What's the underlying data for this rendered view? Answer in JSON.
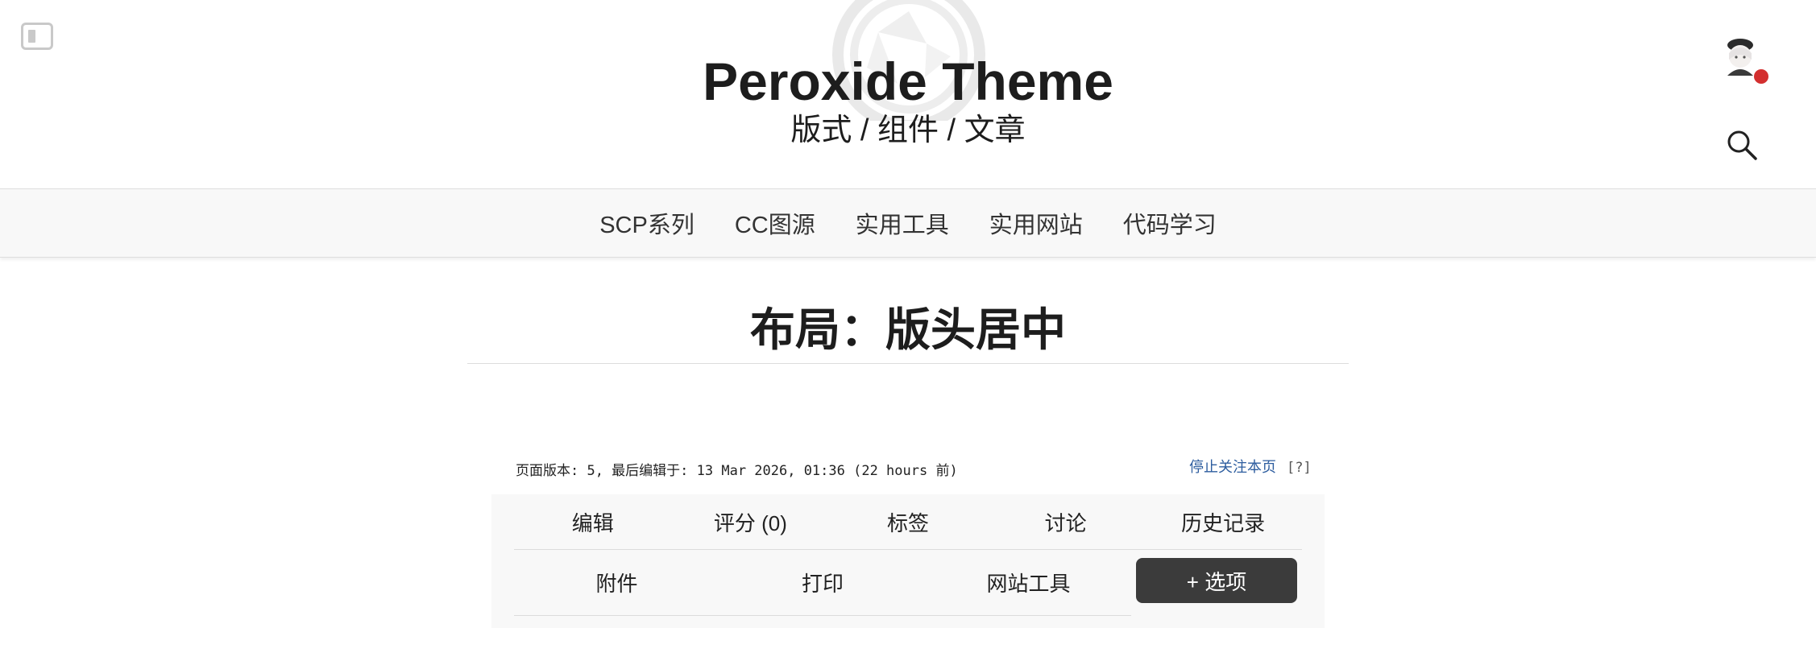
{
  "header": {
    "site_title": "Peroxide Theme",
    "site_subtitle": "版式 / 组件 / 文章",
    "notification_color": "#d32f2f"
  },
  "icons": {
    "sidebar_toggle": "sidebar-toggle-icon",
    "logo": "aperture-logo-icon",
    "avatar": "user-avatar",
    "search": "search-icon"
  },
  "nav": {
    "items": [
      "SCP系列",
      "CC图源",
      "实用工具",
      "实用网站",
      "代码学习"
    ]
  },
  "page": {
    "title": "布局：版头居中"
  },
  "page_info": {
    "revision_text": "页面版本: 5, 最后编辑于: 13 Mar 2026, 01:36 (22 hours 前)",
    "watch_label": "停止关注本页",
    "help_label": "[?]"
  },
  "options": {
    "row1": [
      "编辑",
      "评分 (0)",
      "标签",
      "讨论",
      "历史记录"
    ],
    "row2": [
      "附件",
      "打印",
      "网站工具"
    ],
    "more_label": "+ 选项",
    "more_bg": "#3b3b3b"
  }
}
